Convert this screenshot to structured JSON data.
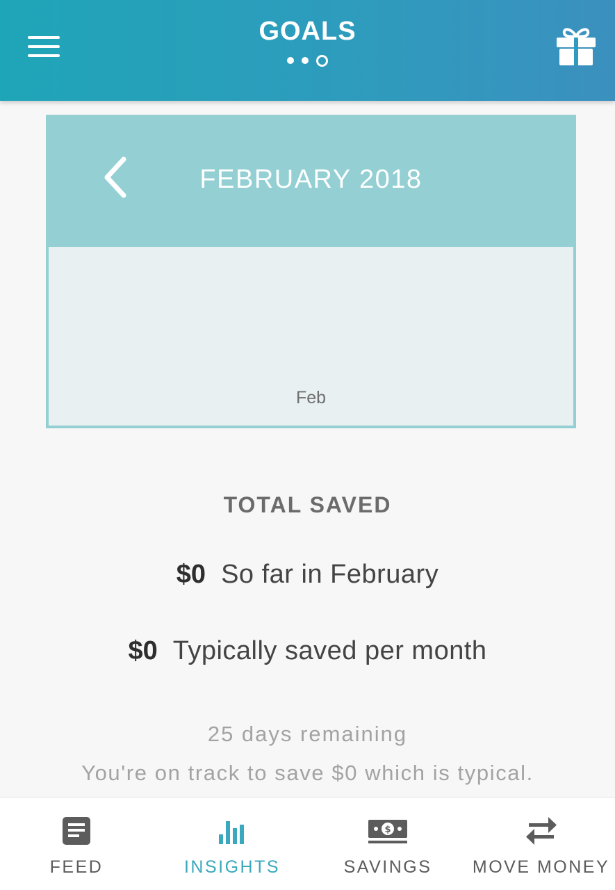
{
  "header": {
    "title": "GOALS",
    "pager": {
      "count": 3,
      "active_index": 2
    }
  },
  "month_card": {
    "title": "FEBRUARY 2018",
    "chart_label": "Feb"
  },
  "totals": {
    "heading": "TOTAL SAVED",
    "rows": [
      {
        "amount": "$0",
        "label": "So far in February"
      },
      {
        "amount": "$0",
        "label": "Typically saved per month"
      }
    ],
    "remaining": "25 days remaining",
    "projection": "You're on track to save $0 which is typical."
  },
  "bottom_nav": {
    "items": [
      {
        "label": "FEED",
        "icon": "feed-icon",
        "active": false
      },
      {
        "label": "INSIGHTS",
        "icon": "bar-chart-icon",
        "active": true
      },
      {
        "label": "SAVINGS",
        "icon": "cash-icon",
        "active": false
      },
      {
        "label": "MOVE MONEY",
        "icon": "transfer-arrows-icon",
        "active": false
      }
    ]
  },
  "colors": {
    "header_start": "#1fa5b8",
    "header_end": "#3b90be",
    "card": "#93cfd3",
    "chart_bg": "#e8f0f1",
    "active_tab": "#3aa9bd"
  }
}
